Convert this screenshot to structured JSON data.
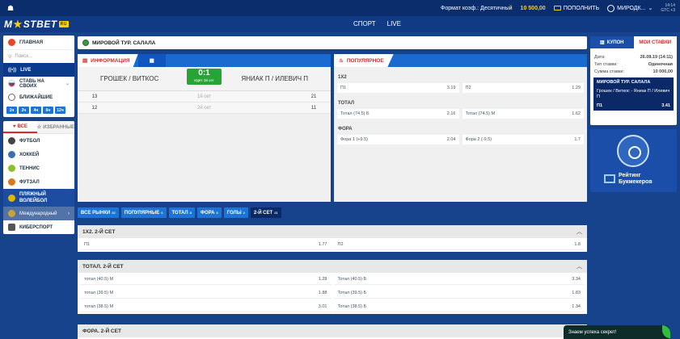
{
  "topbar": {
    "odds_format": "Формат коэф.: Десятичный",
    "balance": "10 500,00",
    "deposit": "ПОПОЛНИТЬ",
    "user": "МИРОДК...",
    "time": "14:14",
    "tz": "GTC +3"
  },
  "header": {
    "logo_main": "MOSTBET",
    "logo_ru": "RU",
    "nav": [
      "СПОРТ",
      "LIVE"
    ]
  },
  "sidebar": {
    "home": "ГЛАВНАЯ",
    "search_placeholder": "Поиск...",
    "live": "LIVE",
    "own_bet": "СТАВЬ НА СВОИХ",
    "nearest": "БЛИЖАЙШИЕ",
    "filters": [
      "1ч",
      "2ч",
      "4ч",
      "6ч",
      "12ч"
    ],
    "tab_all": "ВСЕ",
    "tab_fav": "ИЗБРАННЫЕ",
    "sports": [
      "ФУТБОЛ",
      "ХОККЕЙ",
      "ТЕННИС",
      "ФУТЗАЛ"
    ],
    "selected": "ПЛЯЖНЫЙ ВОЛЕЙБОЛ",
    "sub": "Международный",
    "esport": "КИБЕРСПОРТ",
    "colors": {
      "football": "#444444",
      "hockey": "#3a6fb0",
      "tennis": "#8bbf2c",
      "futsal": "#d87a1c",
      "volley": "#e0b600",
      "esport": "#555555"
    }
  },
  "event": {
    "title": "МИРОВОЙ ТУР. САЛАЛА"
  },
  "info_panel": {
    "tab_info": "ИНФОРМАЦИЯ",
    "team_left": "ГРОШЕК / ВИТКОС",
    "team_right": "ЯНИАК П / ИЛЕВИЧ П",
    "score": "0:1",
    "status": "Идёт 2й сет",
    "sets": [
      {
        "left": "13",
        "label": "1й сет",
        "right": "21"
      },
      {
        "left": "12",
        "label": "2й сет",
        "right": "11"
      }
    ]
  },
  "popular": {
    "tab": "ПОПУЛЯРНОЕ",
    "groups": [
      {
        "title": "1Х2",
        "odds": [
          {
            "name": "П1",
            "value": "3.19"
          },
          {
            "name": "П2",
            "value": "1.29"
          }
        ]
      },
      {
        "title": "ТОТАЛ",
        "odds": [
          {
            "name": "Тотал (74.5) Б",
            "value": "2.16"
          },
          {
            "name": "Тотал (74.5) М",
            "value": "1.62"
          }
        ]
      },
      {
        "title": "ФОРА",
        "odds": [
          {
            "name": "Фора 1 (+9.5)",
            "value": "2.04"
          },
          {
            "name": "Фора 2 (-9.5)",
            "value": "1.7"
          }
        ]
      }
    ]
  },
  "market_tabs": [
    {
      "label": "ВСЕ РЫНКИ",
      "count": "32"
    },
    {
      "label": "ПОПУЛЯРНЫЕ",
      "count": "6"
    },
    {
      "label": "ТОТАЛ",
      "count": "8"
    },
    {
      "label": "ФОРА",
      "count": "6"
    },
    {
      "label": "ГОЛЫ",
      "count": "2"
    },
    {
      "label": "2-Й СЕТ",
      "count": "21"
    }
  ],
  "markets": [
    {
      "title": "1Х2. 2-Й СЕТ",
      "rows": [
        [
          {
            "name": "П1",
            "value": "1.77"
          },
          {
            "name": "П2",
            "value": "1.8"
          }
        ]
      ]
    },
    {
      "title": "ТОТАЛ. 2-Й СЕТ",
      "rows": [
        [
          {
            "name": "тотал (40.5) М",
            "value": "1.28"
          },
          {
            "name": "Тотал (40.5) Б",
            "value": "3.34"
          }
        ],
        [
          {
            "name": "тотал (39.5) М",
            "value": "1.88"
          },
          {
            "name": "Тотал (39.5) Б",
            "value": "1.83"
          }
        ],
        [
          {
            "name": "тотал (38.5) М",
            "value": "3.01"
          },
          {
            "name": "Тотал (38.5) Б",
            "value": "1.34"
          }
        ]
      ]
    },
    {
      "title": "ФОРА. 2-Й СЕТ",
      "rows": []
    }
  ],
  "coupon": {
    "tab_coupon": "КУПОН",
    "tab_mybets": "МОИ СТАВКИ",
    "date_label": "Дата:",
    "date_value": "26.08.19 (14:11)",
    "type_label": "Тип ставки:",
    "type_value": "Одиночная",
    "sum_label": "Сумма ставки:",
    "sum_value": "10 000,00",
    "bet_event": "МИРОВОЙ ТУР. САЛАЛА",
    "bet_match": "Грошек / Виткос - Яниак П / Илевич П",
    "bet_outcome": "П1",
    "bet_odd": "3.41"
  },
  "rating": {
    "text_line1": "Рейтинг",
    "text_line2": "Букмекеров"
  },
  "chat": {
    "text": "Знаем успеха секрет!"
  }
}
